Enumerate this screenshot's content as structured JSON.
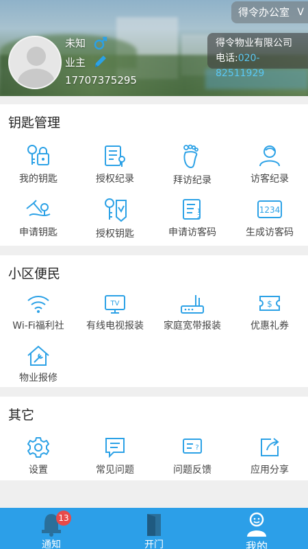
{
  "colors": {
    "accent": "#2c9fe8",
    "icon": "#2ba1e6",
    "phone": "#5ac8f5",
    "badge": "#e84a4a"
  },
  "header": {
    "office_switch": "得令办公室",
    "office_chevron": "V",
    "user": {
      "name": "未知",
      "role": "业主",
      "phone": "17707375295"
    },
    "company": {
      "name": "得令物业有限公司",
      "tel_label": "电话:",
      "tel": "020-82511929"
    }
  },
  "keys": {
    "title": "钥匙管理",
    "items": [
      {
        "label": "我的钥匙",
        "icon": "key-lock-icon"
      },
      {
        "label": "授权纪录",
        "icon": "auth-record-icon"
      },
      {
        "label": "拜访纪录",
        "icon": "footprint-icon"
      },
      {
        "label": "访客纪录",
        "icon": "visitor-icon"
      },
      {
        "label": "申请钥匙",
        "icon": "apply-key-icon"
      },
      {
        "label": "授权钥匙",
        "icon": "grant-key-icon"
      },
      {
        "label": "申请访客码",
        "icon": "code-list-icon"
      },
      {
        "label": "生成访客码",
        "icon": "code-1234-icon",
        "glyph": "1234"
      }
    ]
  },
  "community": {
    "title": "小区便民",
    "items": [
      {
        "label": "Wi-Fi福利社",
        "icon": "wifi-icon"
      },
      {
        "label": "有线电视报装",
        "icon": "tv-icon",
        "glyph": "TV"
      },
      {
        "label": "家庭宽带报装",
        "icon": "router-icon"
      },
      {
        "label": "优惠礼券",
        "icon": "coupon-icon",
        "glyph": "$"
      },
      {
        "label": "物业报修",
        "icon": "house-repair-icon"
      }
    ]
  },
  "other": {
    "title": "其它",
    "items": [
      {
        "label": "设置",
        "icon": "gear-icon"
      },
      {
        "label": "常见问题",
        "icon": "faq-icon"
      },
      {
        "label": "问题反馈",
        "icon": "feedback-icon"
      },
      {
        "label": "应用分享",
        "icon": "share-icon"
      }
    ]
  },
  "tabbar": {
    "tabs": [
      {
        "label": "通知",
        "icon": "bell-icon",
        "badge": "13"
      },
      {
        "label": "开门",
        "icon": "door-icon"
      },
      {
        "label": "我的",
        "icon": "me-icon",
        "active": true
      }
    ]
  }
}
